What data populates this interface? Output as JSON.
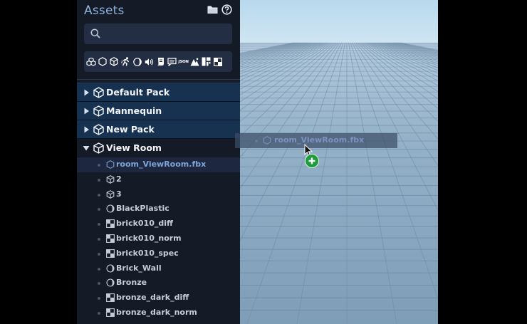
{
  "panel": {
    "title": "Assets",
    "search_placeholder": "",
    "filter_icons": [
      "model-group-icon",
      "hexagon-icon",
      "cube-icon",
      "animation-icon",
      "material-icon",
      "audio-icon",
      "script-icon",
      "text-icon",
      "json-icon",
      "terrain-icon",
      "texture-atlas-icon",
      "texture-icon"
    ],
    "json_label": "JSON"
  },
  "packs": [
    {
      "label": "Default Pack",
      "expanded": false
    },
    {
      "label": "Mannequin",
      "expanded": false
    },
    {
      "label": "New Pack",
      "expanded": false
    },
    {
      "label": "View Room",
      "expanded": true
    }
  ],
  "assets": [
    {
      "label": "room_ViewRoom.fbx",
      "icon": "hexagon-icon",
      "selected": true
    },
    {
      "label": "2",
      "icon": "cube-icon"
    },
    {
      "label": "3",
      "icon": "cube-icon"
    },
    {
      "label": "BlackPlastic",
      "icon": "material-icon"
    },
    {
      "label": "brick010_diff",
      "icon": "texture-icon"
    },
    {
      "label": "brick010_norm",
      "icon": "texture-icon"
    },
    {
      "label": "brick010_spec",
      "icon": "texture-icon"
    },
    {
      "label": "Brick_Wall",
      "icon": "material-icon"
    },
    {
      "label": "Bronze",
      "icon": "material-icon"
    },
    {
      "label": "bronze_dark_diff",
      "icon": "texture-icon"
    },
    {
      "label": "bronze_dark_norm",
      "icon": "texture-icon"
    }
  ],
  "drag_ghost": {
    "label": "room_ViewRoom.fbx",
    "icon": "hexagon-icon"
  },
  "colors": {
    "panel_bg": "#141b27",
    "pack_highlight": "#173151",
    "sky": "#c3deef",
    "ground": "#8ba9c2",
    "add_green": "#1e9b3a"
  }
}
